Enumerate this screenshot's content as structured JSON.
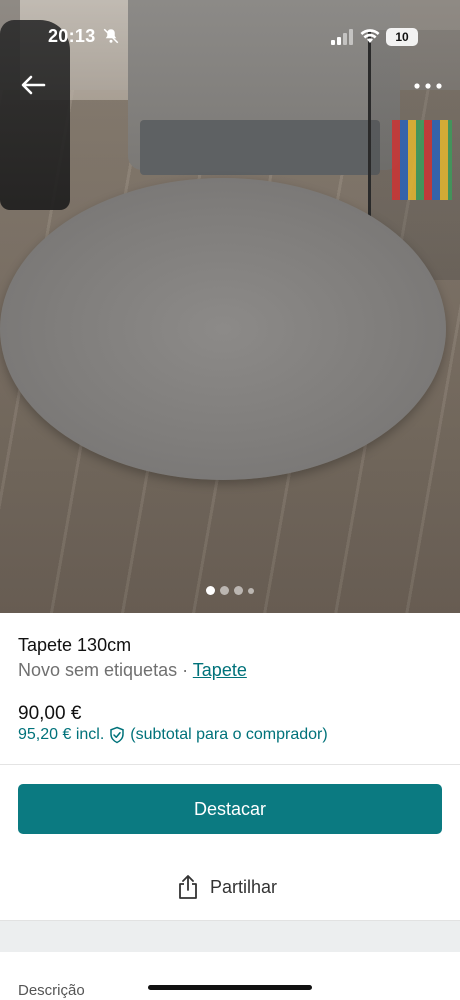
{
  "status_bar": {
    "time": "20:13",
    "battery": "10",
    "icons": [
      "bell-off-icon",
      "signal-icon",
      "wifi-icon",
      "battery-icon"
    ]
  },
  "photo": {
    "image_count": 4,
    "active_index": 0,
    "back_icon": "arrow-left-icon",
    "more_icon": "more-horizontal-icon"
  },
  "listing": {
    "title": "Tapete 130cm",
    "condition": "Novo sem etiquetas",
    "separator": "·",
    "category_link": "Tapete",
    "price": "90,00 €",
    "price_incl": "95,20 € incl.",
    "price_incl_note": "(subtotal para o comprador)",
    "shield_icon": "shield-check-icon"
  },
  "actions": {
    "highlight_label": "Destacar",
    "share_label": "Partilhar",
    "share_icon": "share-icon"
  },
  "description": {
    "label": "Descrição"
  },
  "colors": {
    "accent": "#0b7a81",
    "link": "#00727a"
  }
}
